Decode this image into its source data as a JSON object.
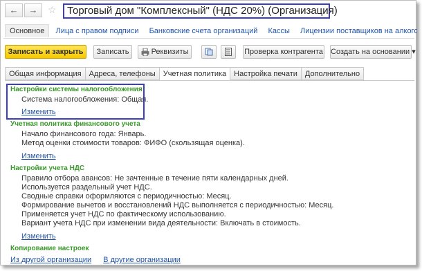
{
  "window": {
    "back_glyph": "←",
    "forward_glyph": "→",
    "star_glyph": "☆",
    "title": "Торговый дом \"Комплексный\" (НДС 20%) (Организация)"
  },
  "section_tabs": [
    "Основное",
    "Лица с правом подписи",
    "Банковские счета организаций",
    "Кассы",
    "Лицензии поставщиков на алкогольную и спиртосо"
  ],
  "toolbar": {
    "save_close": "Записать и закрыть",
    "save": "Записать",
    "requisites": "Реквизиты",
    "check_counterparty": "Проверка контрагента",
    "create_based_on": "Создать на основании",
    "dropdown_glyph": "▾"
  },
  "sub_tabs": [
    "Общая информация",
    "Адреса, телефоны",
    "Учетная политика",
    "Настройка печати",
    "Дополнительно"
  ],
  "tax": {
    "header": "Настройки системы налогообложения",
    "line": "Система налогообложения: Общая.",
    "change": "Изменить"
  },
  "fin_policy": {
    "header": "Учетная политика финансового учета",
    "lines": [
      "Начало финансового года: Январь.",
      "Метод оценки стоимости товаров: ФИФО (скользящая оценка)."
    ],
    "change": "Изменить"
  },
  "vat": {
    "header": "Настройки учета НДС",
    "lines": [
      "Правило отбора авансов: Не зачтенные в течение пяти календарных дней.",
      "Используется раздельный учет НДС.",
      "Сводные справки оформляются с периодичностью: Месяц.",
      "Формирование вычетов и восстановлений НДС выполняется с периодичностью: Месяц.",
      "Применяется учет НДС по фактическому использованию.",
      "Вариант учета НДС при изменении вида деятельности: Включать в стоимость."
    ],
    "change": "Изменить"
  },
  "copy": {
    "header": "Копирование настроек",
    "from_other": "Из другой организации",
    "to_other": "В другие организации"
  }
}
